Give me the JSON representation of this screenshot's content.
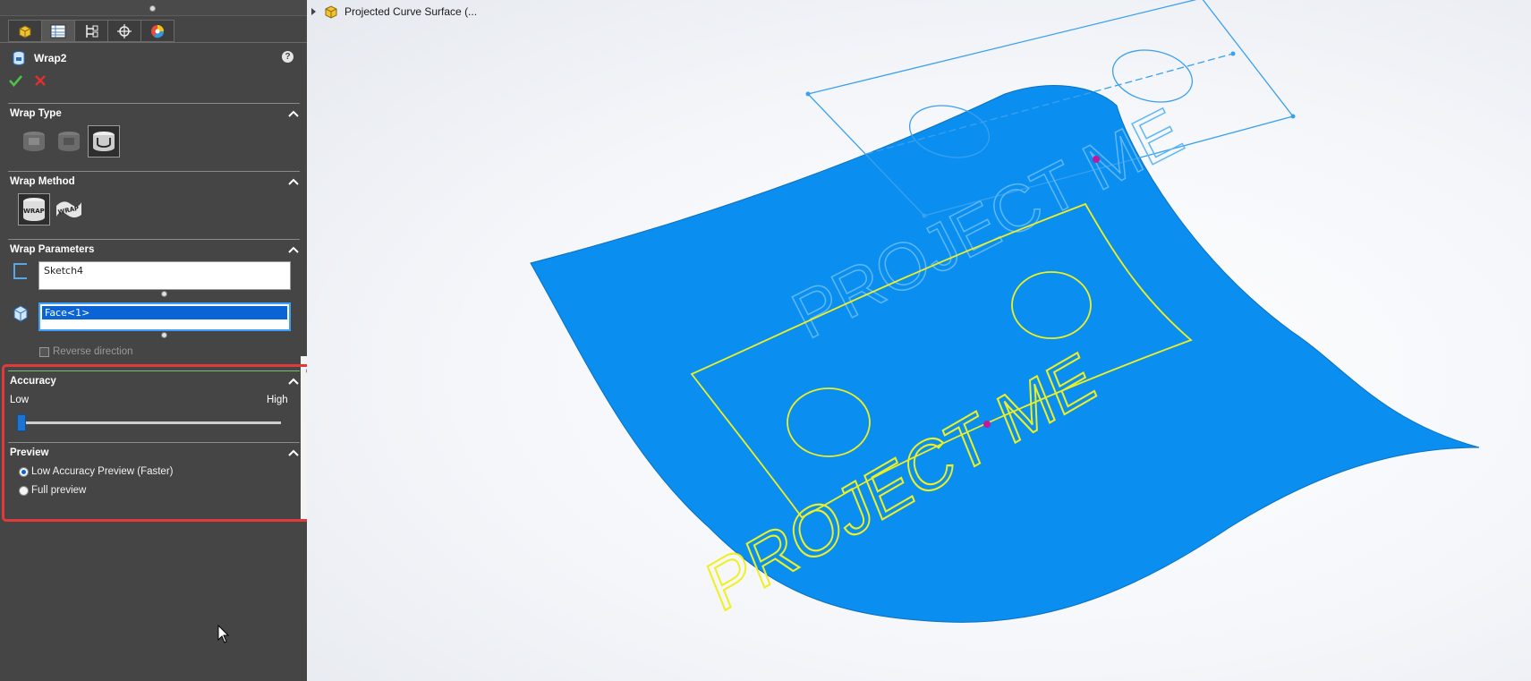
{
  "feature": {
    "title": "Wrap2",
    "help": "?"
  },
  "tabs": [
    {
      "name": "feature-manager",
      "icon": "feature-manager-icon"
    },
    {
      "name": "property-manager",
      "icon": "property-manager-icon"
    },
    {
      "name": "configuration-manager",
      "icon": "configuration-manager-icon"
    },
    {
      "name": "dimxpert-manager",
      "icon": "dimxpert-manager-icon"
    },
    {
      "name": "display-manager",
      "icon": "display-manager-icon"
    }
  ],
  "wrap_type": {
    "title": "Wrap Type",
    "options": [
      "Emboss",
      "Deboss",
      "Scribe"
    ],
    "selected": "Scribe"
  },
  "wrap_method": {
    "title": "Wrap Method",
    "options": [
      "Analytical",
      "Spline Surface"
    ],
    "selected": "Analytical"
  },
  "wrap_parameters": {
    "title": "Wrap Parameters",
    "sketch_value": "Sketch4",
    "face_value": "Face<1>",
    "reverse_label": "Reverse direction",
    "reverse_checked": false
  },
  "accuracy": {
    "title": "Accuracy",
    "low_label": "Low",
    "high_label": "High",
    "level": 0
  },
  "preview": {
    "title": "Preview",
    "options": [
      "Low Accuracy Preview (Faster)",
      "Full preview"
    ],
    "selected_index": 0
  },
  "tree": {
    "node_label": "Projected Curve Surface (..."
  },
  "viewport": {
    "surface_color": "#0a8ff0",
    "curve_color": "#f0f020",
    "text_projected": "PROJECT ME",
    "text_front": "PROJECT ME"
  },
  "colors": {
    "panel_bg": "#454545",
    "highlight": "#e23a3a",
    "accent": "#0a64d6"
  }
}
